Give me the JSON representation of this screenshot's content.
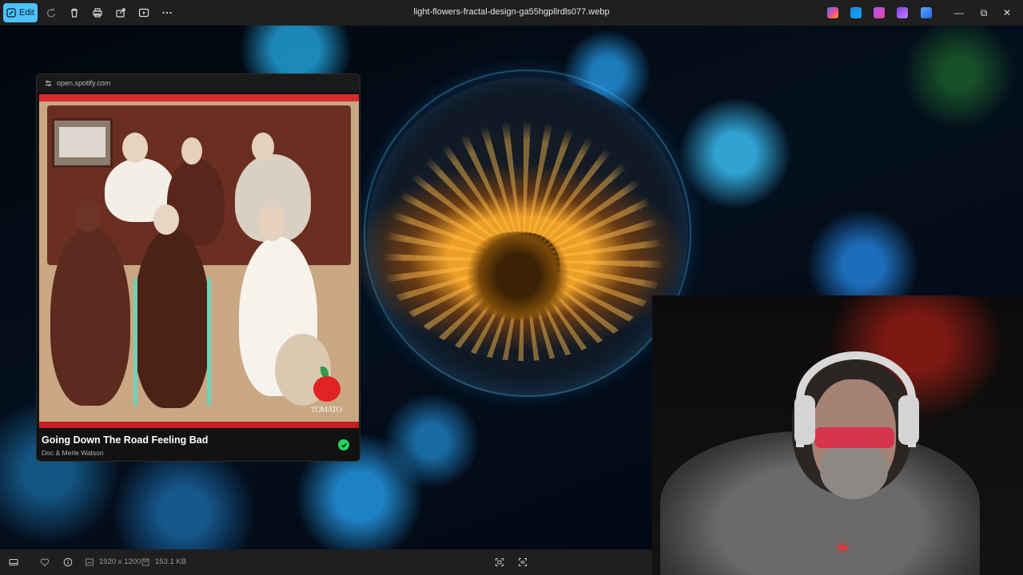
{
  "toolbar": {
    "edit_label": "Edit",
    "icons": [
      "edit-pencil-icon",
      "rotate-icon",
      "delete-icon",
      "print-icon",
      "share-icon",
      "slideshow-icon",
      "more-icon"
    ]
  },
  "window": {
    "file_title": "light-flowers-fractal-design-ga55hgpllrdls077.webp",
    "controls": {
      "minimize": "—",
      "restore": "⧉",
      "close": "✕"
    }
  },
  "taskbar_apps": [
    {
      "name": "copilot-app-icon",
      "color": "#3b82f6"
    },
    {
      "name": "edit-app-icon",
      "color": "#1e88e5"
    },
    {
      "name": "clipchamp-app-icon",
      "color": "#a855f7"
    },
    {
      "name": "media-app-icon",
      "color": "#7c3aed"
    },
    {
      "name": "onedrive-app-icon",
      "color": "#60a5fa"
    }
  ],
  "spotify": {
    "url": "open.spotify.com",
    "track_title": "Going Down The Road Feeling Bad",
    "artist": "Doc & Merle Watson",
    "album_mark": "TOMATO",
    "accent": "#1ed760"
  },
  "status": {
    "dimensions": "1920 x 1200",
    "file_size": "153.1 KB"
  }
}
